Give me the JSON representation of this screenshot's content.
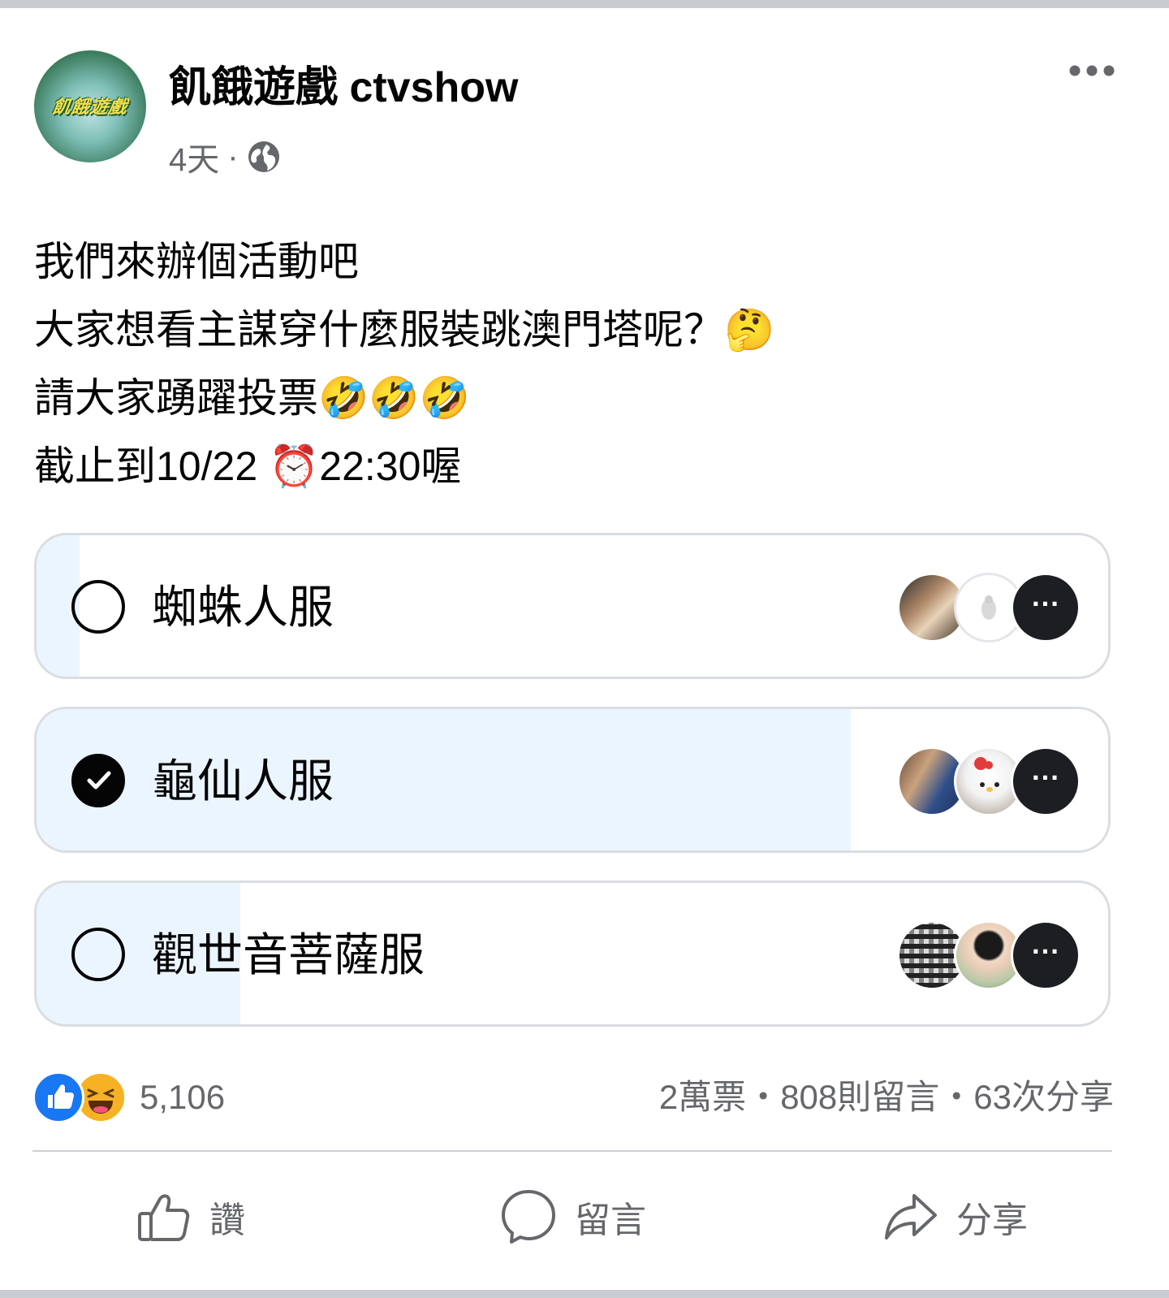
{
  "post": {
    "page_name": "飢餓遊戲 ctvshow",
    "avatar_text": "飢餓遊戲",
    "time": "4天",
    "separator": "·",
    "audience_icon": "globe-icon",
    "more_icon": "more-dots-icon",
    "text_lines": [
      "我們來辦個活動吧",
      "大家想看主謀穿什麼服裝跳澳門塔呢？🤔",
      "請大家踴躍投票🤣🤣🤣",
      "截止到10/22 ⏰22:30喔"
    ]
  },
  "poll": {
    "options": [
      {
        "label": "蜘蛛人服",
        "selected": false,
        "vote_share": 0.04,
        "more_voters_label": "···"
      },
      {
        "label": "龜仙人服",
        "selected": true,
        "vote_share": 0.76,
        "more_voters_label": "···"
      },
      {
        "label": "觀世音菩薩服",
        "selected": false,
        "vote_share": 0.19,
        "more_voters_label": "···"
      }
    ]
  },
  "engagement": {
    "reaction_icons": [
      "like-reaction-icon",
      "haha-reaction-icon"
    ],
    "reaction_count": "5,106",
    "votes": "2萬票",
    "comments": "808則留言",
    "shares": "63次分享",
    "sep": "・"
  },
  "actions": {
    "like": "讚",
    "comment": "留言",
    "share": "分享"
  },
  "colors": {
    "poll_fill": "#ebf5ff",
    "like_blue": "#1877f2",
    "text_secondary": "#65676b"
  }
}
